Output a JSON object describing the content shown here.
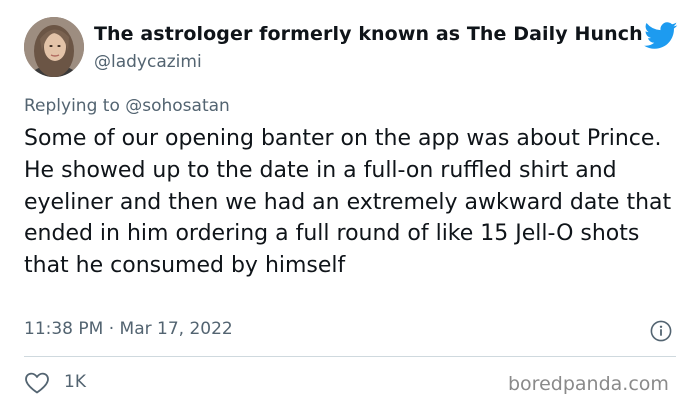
{
  "author": {
    "display_name": "The astrologer formerly known as The Daily Hunch",
    "handle": "@ladycazimi",
    "avatar_icon": "profile-photo",
    "verified_icon": "twitter-bird-icon"
  },
  "reply": {
    "prefix": "Replying to ",
    "mention": "@sohosatan"
  },
  "tweet": {
    "text": "Some of our opening banter on the app was about Prince. He showed up to the date in a full-on ruffled shirt and eyeliner and then we had an extremely awkward date that ended in him ordering a full round of like 15 Jell-O shots that he consumed by himself",
    "timestamp": "11:38 PM · Mar 17, 2022"
  },
  "actions": {
    "like_count": "1K",
    "like_icon": "heart-icon",
    "info_icon": "info-icon"
  },
  "watermark": "boredpanda.com",
  "colors": {
    "twitter_blue": "#1d9bf0",
    "secondary_text": "#536471",
    "divider": "#cfd9de"
  }
}
